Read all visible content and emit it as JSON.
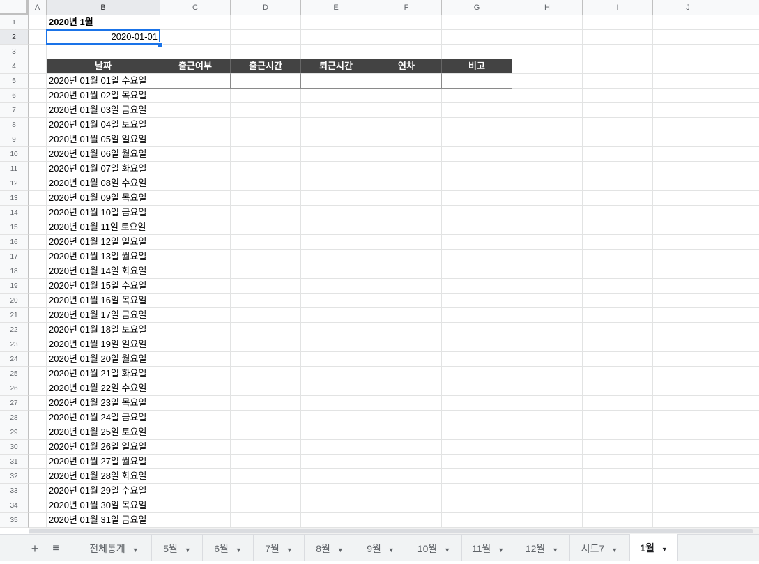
{
  "columns": [
    "A",
    "B",
    "C",
    "D",
    "E",
    "F",
    "G",
    "H",
    "I",
    "J"
  ],
  "title_cell": "2020년 1월",
  "date_cell": "2020-01-01",
  "table_headers": [
    "날짜",
    "출근여부",
    "출근시간",
    "퇴근시간",
    "연차",
    "비고"
  ],
  "dates": [
    "2020년 01월 01일 수요일",
    "2020년 01월 02일 목요일",
    "2020년 01월 03일 금요일",
    "2020년 01월 04일 토요일",
    "2020년 01월 05일 일요일",
    "2020년 01월 06일 월요일",
    "2020년 01월 07일 화요일",
    "2020년 01월 08일 수요일",
    "2020년 01월 09일 목요일",
    "2020년 01월 10일 금요일",
    "2020년 01월 11일 토요일",
    "2020년 01월 12일 일요일",
    "2020년 01월 13일 월요일",
    "2020년 01월 14일 화요일",
    "2020년 01월 15일 수요일",
    "2020년 01월 16일 목요일",
    "2020년 01월 17일 금요일",
    "2020년 01월 18일 토요일",
    "2020년 01월 19일 일요일",
    "2020년 01월 20일 월요일",
    "2020년 01월 21일 화요일",
    "2020년 01월 22일 수요일",
    "2020년 01월 23일 목요일",
    "2020년 01월 24일 금요일",
    "2020년 01월 25일 토요일",
    "2020년 01월 26일 일요일",
    "2020년 01월 27일 월요일",
    "2020년 01월 28일 화요일",
    "2020년 01월 29일 수요일",
    "2020년 01월 30일 목요일",
    "2020년 01월 31일 금요일"
  ],
  "sheet_tabs": [
    "전체통계",
    "5월",
    "6월",
    "7월",
    "8월",
    "9월",
    "10월",
    "11월",
    "12월",
    "시트7",
    "1월"
  ],
  "active_tab": "1월",
  "icons": {
    "add_sheet": "plus-icon",
    "all_sheets": "menu-icon",
    "tab_menu": "caret-down-icon"
  },
  "colors": {
    "header_fill": "#434343",
    "header_text": "#ffffff",
    "selection": "#1a73e8",
    "active_tab": "#188038"
  }
}
